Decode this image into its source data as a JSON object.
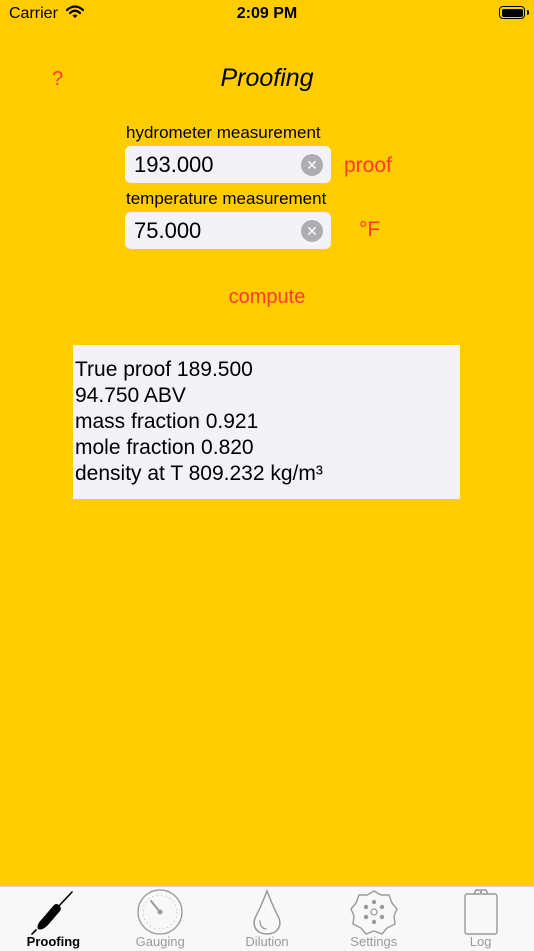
{
  "status_bar": {
    "carrier": "Carrier",
    "time": "2:09 PM"
  },
  "header": {
    "help": "?",
    "title": "Proofing"
  },
  "hydrometer": {
    "label": "hydrometer measurement",
    "value": "193.000",
    "unit": "proof"
  },
  "temperature": {
    "label": "temperature measurement",
    "value": "75.000",
    "unit": "°F"
  },
  "compute_label": "compute",
  "results": {
    "lines": [
      "True proof 189.500",
      "94.750 ABV",
      "mass fraction 0.921",
      "mole fraction 0.820",
      "density at T 809.232 kg/m³"
    ]
  },
  "tabs": [
    {
      "label": "Proofing",
      "icon": "hydrometer-icon",
      "active": true
    },
    {
      "label": "Gauging",
      "icon": "gauge-icon",
      "active": false
    },
    {
      "label": "Dilution",
      "icon": "drop-icon",
      "active": false
    },
    {
      "label": "Settings",
      "icon": "settings-icon",
      "active": false
    },
    {
      "label": "Log",
      "icon": "clipboard-icon",
      "active": false
    }
  ],
  "colors": {
    "background": "#FFCC00",
    "accent": "#FF3B30",
    "field": "#F2F2F7"
  }
}
